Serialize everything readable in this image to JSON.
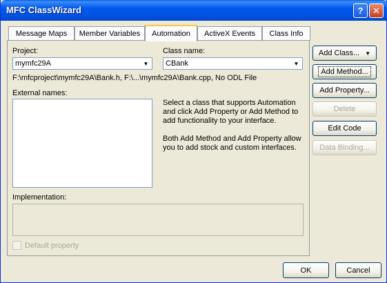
{
  "window": {
    "title": "MFC ClassWizard",
    "help_label": "?",
    "close_label": "✕"
  },
  "tabs": [
    {
      "label": "Message Maps"
    },
    {
      "label": "Member Variables"
    },
    {
      "label": "Automation"
    },
    {
      "label": "ActiveX Events"
    },
    {
      "label": "Class Info"
    }
  ],
  "active_tab": "Automation",
  "project": {
    "label": "Project:",
    "value": "mymfc29A"
  },
  "class_name": {
    "label": "Class name:",
    "value": "CBank"
  },
  "files_path": "F:\\mfcproject\\mymfc29A\\Bank.h, F:\\...\\mymfc29A\\Bank.cpp, No ODL File",
  "external_names": {
    "label": "External names:"
  },
  "info": {
    "line1": "Select a class that supports Automation",
    "line2": "and click Add Property or Add Method to",
    "line3": "add functionality to your interface.",
    "line4": "Both Add Method and Add Property allow",
    "line5": "you to add stock and custom interfaces."
  },
  "implementation": {
    "label": "Implementation:"
  },
  "default_property": {
    "label": "Default property",
    "checked": false
  },
  "side_buttons": {
    "add_class": "Add Class...",
    "add_class_arrow": "▼",
    "add_method": "Add Method...",
    "add_property": "Add Property...",
    "delete": "Delete",
    "edit_code": "Edit Code",
    "data_binding": "Data Binding..."
  },
  "bottom_buttons": {
    "ok": "OK",
    "cancel": "Cancel"
  }
}
